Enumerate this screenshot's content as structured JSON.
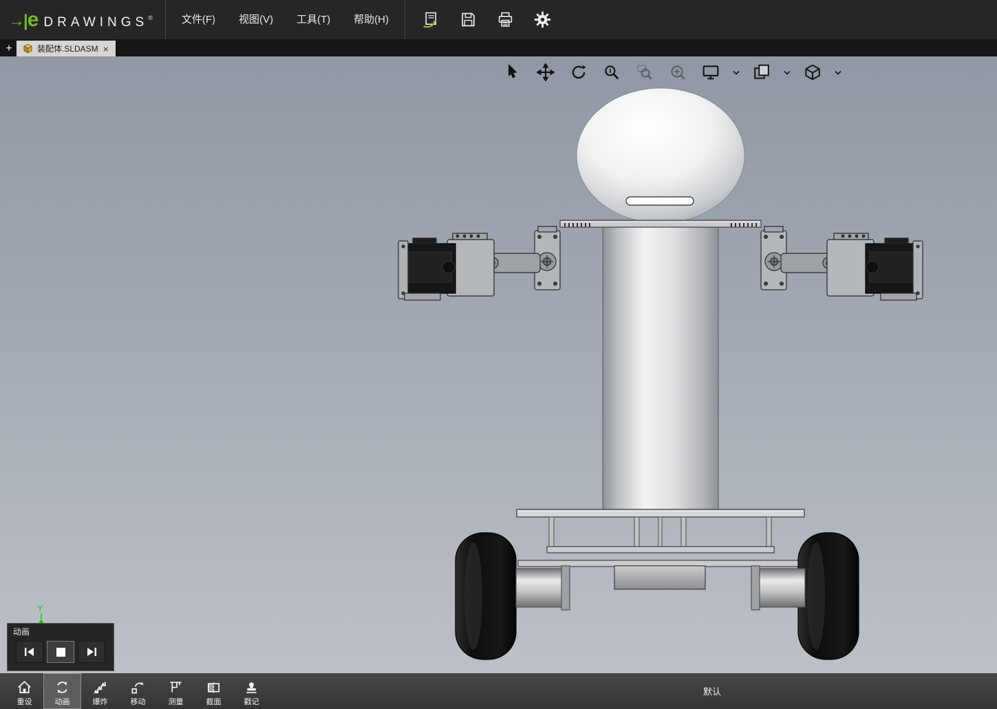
{
  "brand": {
    "arrow": "→|",
    "e": "e",
    "name": "DRAWINGS",
    "reg": "®"
  },
  "menubar": [
    {
      "label": "文件(F)"
    },
    {
      "label": "视图(V)"
    },
    {
      "label": "工具(T)"
    },
    {
      "label": "帮助(H)"
    }
  ],
  "quick_toolbar": {
    "icons": [
      "open-icon",
      "save-icon",
      "print-icon",
      "options-gear-icon"
    ]
  },
  "tabbar": {
    "new_tab": "+",
    "tab_label": "装配体.SLDASM",
    "close": "×"
  },
  "view_toolbar": {
    "icons": [
      "select-icon",
      "pan-icon",
      "rotate-icon",
      "zoom-icon",
      "zoom-area-icon",
      "zoom-fit-icon",
      "display-style-icon",
      "markup-icon",
      "view-orientation-icon"
    ]
  },
  "viewport": {
    "axis_label": "Y"
  },
  "animation_panel": {
    "title": "动画",
    "icons": [
      "previous-frame-icon",
      "stop-icon",
      "next-frame-icon"
    ]
  },
  "bottom_toolbar": {
    "items": [
      {
        "label": "重设",
        "icon": "home-icon",
        "active": false
      },
      {
        "label": "动画",
        "icon": "animation-icon",
        "active": true
      },
      {
        "label": "爆炸",
        "icon": "explode-icon",
        "active": false
      },
      {
        "label": "移动",
        "icon": "move-component-icon",
        "active": false
      },
      {
        "label": "测量",
        "icon": "measure-icon",
        "active": false
      },
      {
        "label": "截面",
        "icon": "section-icon",
        "active": false
      },
      {
        "label": "戳记",
        "icon": "stamp-icon",
        "active": false
      }
    ],
    "status": "默认"
  },
  "colors": {
    "accent_green": "#76b82d",
    "topbar_bg": "#262626",
    "bottombar_bg": "#3a3a3a",
    "viewport_top": "#8f98a4",
    "viewport_bottom": "#bcc1c7",
    "axis_green": "#19c619"
  }
}
